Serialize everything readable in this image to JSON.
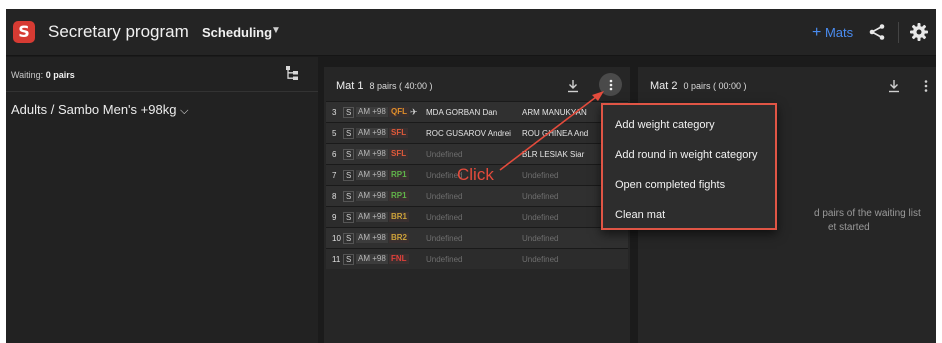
{
  "header": {
    "logo_letter": "S",
    "title": "Secretary program",
    "scheduling_label": "Scheduling",
    "mats_button": {
      "plus": "+",
      "label": "Mats"
    },
    "accent_color": "#4a8cf0",
    "brand_color": "#d63b33"
  },
  "left_panel": {
    "waiting_prefix": "Waiting:",
    "waiting_value": "0 pairs",
    "category_label": "Adults / Sambo Men's +98kg"
  },
  "mat1": {
    "title": "Mat 1",
    "summary": "8 pairs ( 40:00 )",
    "rows": [
      {
        "num": "3",
        "s": "S",
        "age": "AM +98",
        "round": "QFL",
        "round_color": "#e0902a",
        "pin": "✈",
        "red": "MDA GORBAN Dan",
        "blue": "ARM MANUKYAN"
      },
      {
        "num": "5",
        "s": "S",
        "age": "AM +98",
        "round": "SFL",
        "round_color": "#e05a3a",
        "pin": "",
        "red": "ROC GUSAROV Andrei",
        "blue": "ROU GHINEA And"
      },
      {
        "num": "6",
        "s": "S",
        "age": "AM +98",
        "round": "SFL",
        "round_color": "#e05a3a",
        "pin": "",
        "red": "Undefined",
        "blue": "BLR LESIAK Siar"
      },
      {
        "num": "7",
        "s": "S",
        "age": "AM +98",
        "round": "RP1",
        "round_color": "#5fb34a",
        "pin": "",
        "red": "Undefined",
        "blue": "Undefined"
      },
      {
        "num": "8",
        "s": "S",
        "age": "AM +98",
        "round": "RP1",
        "round_color": "#5fb34a",
        "pin": "",
        "red": "Undefined",
        "blue": "Undefined"
      },
      {
        "num": "9",
        "s": "S",
        "age": "AM +98",
        "round": "BR1",
        "round_color": "#c8a23a",
        "pin": "",
        "red": "Undefined",
        "blue": "Undefined"
      },
      {
        "num": "10",
        "s": "S",
        "age": "AM +98",
        "round": "BR2",
        "round_color": "#c8a23a",
        "pin": "",
        "red": "Undefined",
        "blue": "Undefined"
      },
      {
        "num": "11",
        "s": "S",
        "age": "AM +98",
        "round": "FNL",
        "round_color": "#e0403a",
        "pin": "",
        "red": "Undefined",
        "blue": "Undefined"
      }
    ]
  },
  "mat2": {
    "title": "Mat 2",
    "summary": "0 pairs ( 00:00 )",
    "empty_line1": "d pairs of the waiting list",
    "empty_line2": "et started"
  },
  "context_menu": {
    "items": [
      "Add weight category",
      "Add round in weight category",
      "Open completed fights",
      "Clean mat"
    ],
    "highlight_color": "#e05545"
  },
  "annotation": {
    "click_label": "Click"
  }
}
